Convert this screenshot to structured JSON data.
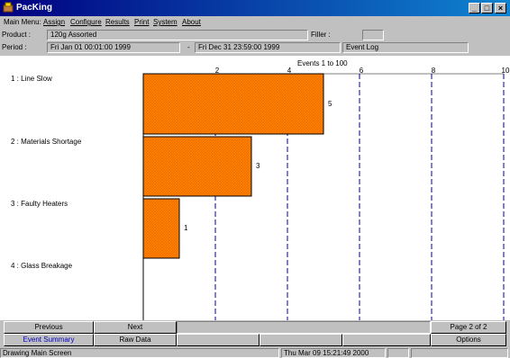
{
  "window": {
    "title": "PacKing",
    "icon": "packing-app-icon",
    "minimize": "_",
    "maximize": "□",
    "close": "×"
  },
  "menu": {
    "label": "Main Menu:",
    "items": [
      "Assign",
      "Configure",
      "Results",
      "Print",
      "System",
      "About"
    ]
  },
  "info": {
    "product_label": "Product :",
    "product_value": "120g Assorted",
    "filler_label": "Filler :",
    "filler_value": "",
    "period_label": "Period :",
    "period_start": "Fri Jan 01 00:01:00 1999",
    "period_sep": "-",
    "period_end": "Fri Dec 31 23:59:00 1999",
    "mode": "Event Log"
  },
  "chart_data": {
    "type": "bar",
    "orientation": "horizontal",
    "subtitle": "Events 1 to 100",
    "categories": [
      "1  : Line Slow",
      "2  : Materials Shortage",
      "3  : Faulty Heaters",
      "4  : Glass Breakage"
    ],
    "values": [
      5,
      3,
      1,
      0
    ],
    "value_labels": [
      "5",
      "3",
      "1",
      ""
    ],
    "xlim": [
      0,
      10
    ],
    "xticks": [
      2,
      4,
      6,
      8,
      10
    ],
    "grid": "vertical dashed",
    "bar_color": "#ff8000"
  },
  "buttons": {
    "previous": "Previous",
    "next": "Next",
    "page": "Page 2 of 2",
    "event_summary": "Event Summary",
    "raw_data": "Raw Data",
    "options": "Options"
  },
  "status": {
    "message": "Drawing Main Screen",
    "datetime": "Thu Mar 09 15:21:49 2000"
  }
}
